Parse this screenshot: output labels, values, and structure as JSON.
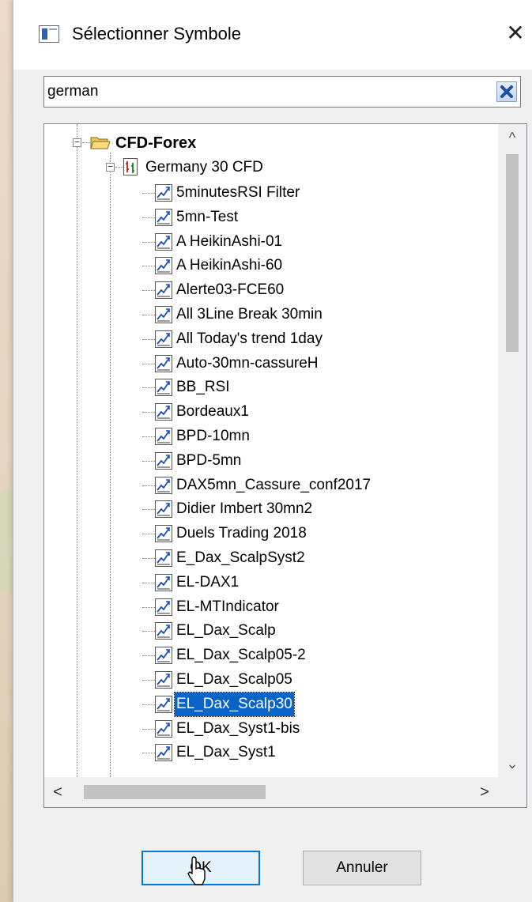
{
  "dialog": {
    "title": "Sélectionner Symbole",
    "close_glyph": "✕"
  },
  "search": {
    "value": "german"
  },
  "tree": {
    "root": {
      "label": "CFD-Forex",
      "icon": "folder-open-icon",
      "expanded": true
    },
    "symbol": {
      "label": "Germany 30 CFD",
      "icon": "symbol-chart-icon",
      "expanded": true
    },
    "items": [
      "5minutesRSI Filter",
      "5mn-Test",
      "A HeikinAshi-01",
      "A HeikinAshi-60",
      "Alerte03-FCE60",
      "All 3Line Break 30min",
      "All Today's trend 1day",
      "Auto-30mn-cassureH",
      "BB_RSI",
      "Bordeaux1",
      "BPD-10mn",
      "BPD-5mn",
      "DAX5mn_Cassure_conf2017",
      "Didier Imbert 30mn2",
      "Duels Trading 2018",
      "E_Dax_ScalpSyst2",
      "EL-DAX1",
      "EL-MTIndicator",
      "EL_Dax_Scalp",
      "EL_Dax_Scalp05-2",
      "EL_Dax_Scalp05",
      "EL_Dax_Scalp30",
      "EL_Dax_Syst1-bis",
      "EL_Dax_Syst1"
    ],
    "selected_item": "EL_Dax_Scalp30",
    "item_icon": "indicator-chart-icon"
  },
  "scrollbars": {
    "up": "^",
    "down": "⌄",
    "left": "<",
    "right": ">"
  },
  "buttons": {
    "ok": "OK",
    "cancel": "Annuler"
  },
  "colors": {
    "selection": "#0a64c8",
    "default_button_border": "#0078d7"
  }
}
